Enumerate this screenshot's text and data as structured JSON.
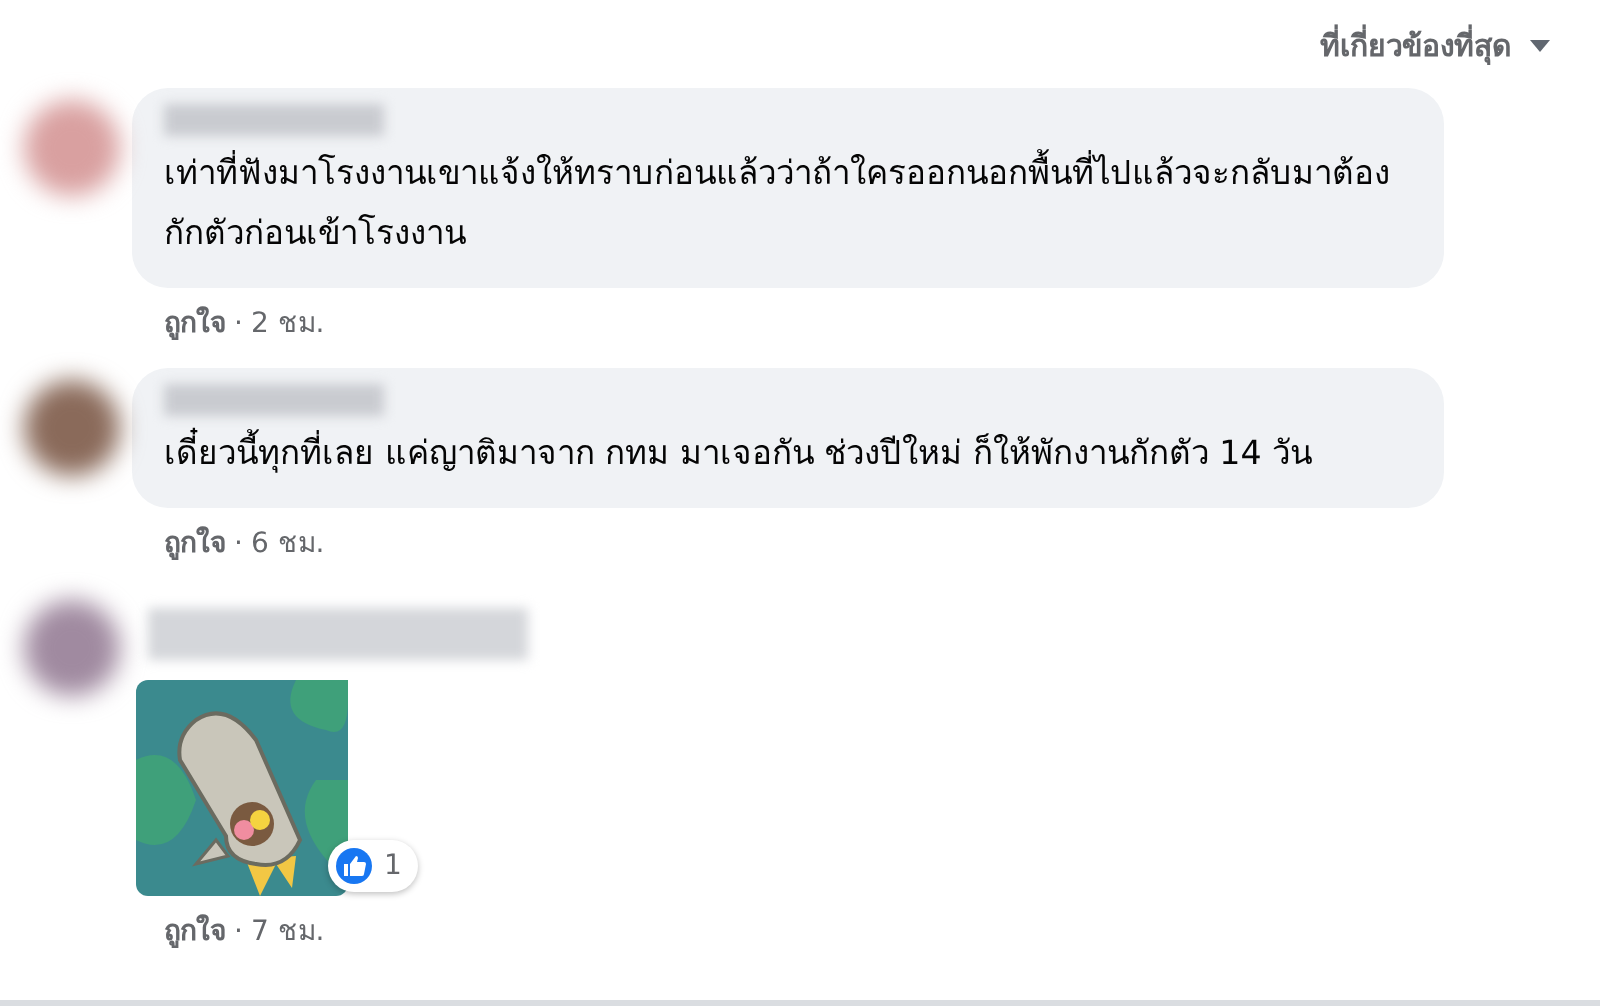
{
  "sort": {
    "label": "ที่เกี่ยวข้องที่สุด"
  },
  "separator": "·",
  "comments": [
    {
      "kind": "text",
      "text": "เท่าที่ฟังมาโรงงานเขาแจ้งให้ทราบก่อนแล้วว่าถ้าใครออกนอกพื้นที่ไปแล้วจะกลับมาต้องกักตัวก่อนเข้าโรงงาน",
      "like": "ถูกใจ",
      "time": "2 ชม."
    },
    {
      "kind": "text",
      "text": "เดี๋ยวนี้ทุกที่เลย แค่ญาติมาจาก กทม มาเจอกัน ช่วงปีใหม่ ก็ให้พักงานกักตัว 14 วัน",
      "like": "ถูกใจ",
      "time": "6 ชม."
    },
    {
      "kind": "sticker",
      "reactions": "1",
      "like": "ถูกใจ",
      "time": "7 ชม."
    }
  ]
}
